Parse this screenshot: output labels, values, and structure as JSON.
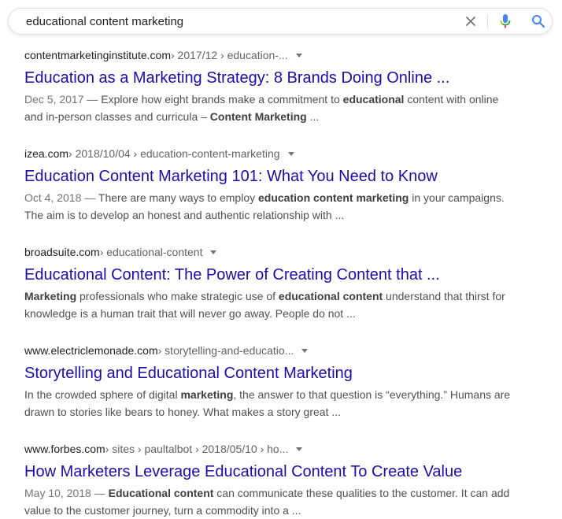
{
  "search": {
    "query": "educational content marketing",
    "clear_icon": "close-icon",
    "voice_icon": "microphone-icon",
    "search_icon": "search-icon"
  },
  "colors": {
    "title_link": "#1a0dab",
    "snippet_text": "#4d5156",
    "date_text": "#70757a",
    "url_host": "#202124"
  },
  "results": [
    {
      "host": "contentmarketinginstitute.com",
      "path": " › 2017/12 › education-...",
      "title": "Education as a Marketing Strategy: 8 Brands Doing Online ...",
      "date": "Dec 5, 2017",
      "snippet": [
        {
          "t": "Explore how eight brands make a commitment to "
        },
        {
          "t": "educational",
          "b": true
        },
        {
          "t": " content with online and in-person classes and curricula – "
        },
        {
          "t": "Content Marketing",
          "b": true
        },
        {
          "t": " ..."
        }
      ]
    },
    {
      "host": "izea.com",
      "path": " › 2018/10/04 › education-content-marketing",
      "title": "Education Content Marketing 101: What You Need to Know",
      "date": "Oct 4, 2018",
      "snippet": [
        {
          "t": "There are many ways to employ "
        },
        {
          "t": "education content marketing",
          "b": true
        },
        {
          "t": " in your campaigns. The aim is to develop an honest and authentic relationship with ..."
        }
      ]
    },
    {
      "host": "broadsuite.com",
      "path": " › educational-content",
      "title": "Educational Content: The Power of Creating Content that ...",
      "date": "",
      "snippet": [
        {
          "t": "Marketing",
          "b": true
        },
        {
          "t": " professionals who make strategic use of "
        },
        {
          "t": "educational content",
          "b": true
        },
        {
          "t": " understand that thirst for knowledge is a human trait that will never go away. People do not ..."
        }
      ]
    },
    {
      "host": "www.electriclemonade.com",
      "path": " › storytelling-and-educatio...",
      "title": "Storytelling and Educational Content Marketing",
      "date": "",
      "snippet": [
        {
          "t": "In the crowded sphere of digital "
        },
        {
          "t": "marketing",
          "b": true
        },
        {
          "t": ", the answer to that question is “everything.” Humans are drawn to stories like bears to honey. What makes a story great ..."
        }
      ]
    },
    {
      "host": "www.forbes.com",
      "path": " › sites › paultalbot › 2018/05/10 › ho...",
      "title": "How Marketers Leverage Educational Content To Create Value",
      "date": "May 10, 2018",
      "snippet": [
        {
          "t": "Educational content",
          "b": true
        },
        {
          "t": " can communicate these qualities to the customer. It can add value to the customer journey, turn a commodity into a ..."
        }
      ]
    }
  ]
}
